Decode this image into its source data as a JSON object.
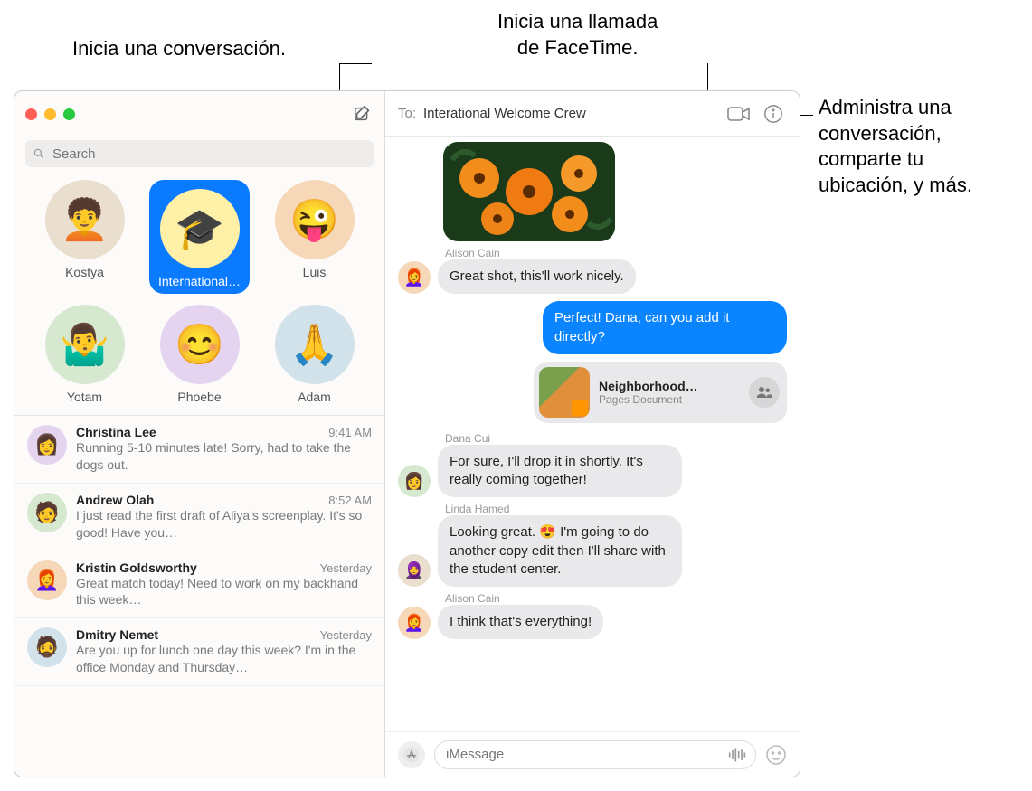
{
  "callouts": {
    "compose": "Inicia una conversación.",
    "facetime": "Inicia una llamada\nde FaceTime.",
    "info": "Administra una\nconversación,\ncomparte tu\nubicación, y más."
  },
  "search": {
    "placeholder": "Search"
  },
  "pins": [
    {
      "name": "Kostya",
      "emoji": "🧑‍🦱",
      "bg": "bg1",
      "selected": false
    },
    {
      "name": "International…",
      "emoji": "🎓",
      "bg": "bg2",
      "selected": true
    },
    {
      "name": "Luis",
      "emoji": "😜",
      "bg": "bg3",
      "selected": false
    },
    {
      "name": "Yotam",
      "emoji": "🤷‍♂️",
      "bg": "bg4",
      "selected": false
    },
    {
      "name": "Phoebe",
      "emoji": "😊",
      "bg": "bg5",
      "selected": false
    },
    {
      "name": "Adam",
      "emoji": "🙏",
      "bg": "bg6",
      "selected": false
    }
  ],
  "conversations": [
    {
      "name": "Christina Lee",
      "time": "9:41 AM",
      "preview": "Running 5-10 minutes late! Sorry, had to take the dogs out.",
      "bg": "bg5"
    },
    {
      "name": "Andrew Olah",
      "time": "8:52 AM",
      "preview": "I just read the first draft of Aliya's screenplay. It's so good! Have you…",
      "bg": "bg4"
    },
    {
      "name": "Kristin Goldsworthy",
      "time": "Yesterday",
      "preview": "Great match today! Need to work on my backhand this week…",
      "bg": "bg3"
    },
    {
      "name": "Dmitry Nemet",
      "time": "Yesterday",
      "preview": "Are you up for lunch one day this week? I'm in the office Monday and Thursday…",
      "bg": "bg6"
    }
  ],
  "header": {
    "to_label": "To:",
    "to_name": "Interational Welcome Crew"
  },
  "messages": {
    "m1_sender": "Alison Cain",
    "m1_text": "Great shot, this'll work nicely.",
    "m2_text": "Perfect! Dana, can you add it directly?",
    "attach_title": "Neighborhood…",
    "attach_sub": "Pages Document",
    "m3_sender": "Dana Cui",
    "m3_text": "For sure, I'll drop it in shortly. It's really coming together!",
    "m4_sender": "Linda Hamed",
    "m4_text": "Looking great. 😍 I'm going to do another copy edit then I'll share with the student center.",
    "m5_sender": "Alison Cain",
    "m5_text": "I think that's everything!"
  },
  "composer": {
    "placeholder": "iMessage"
  }
}
